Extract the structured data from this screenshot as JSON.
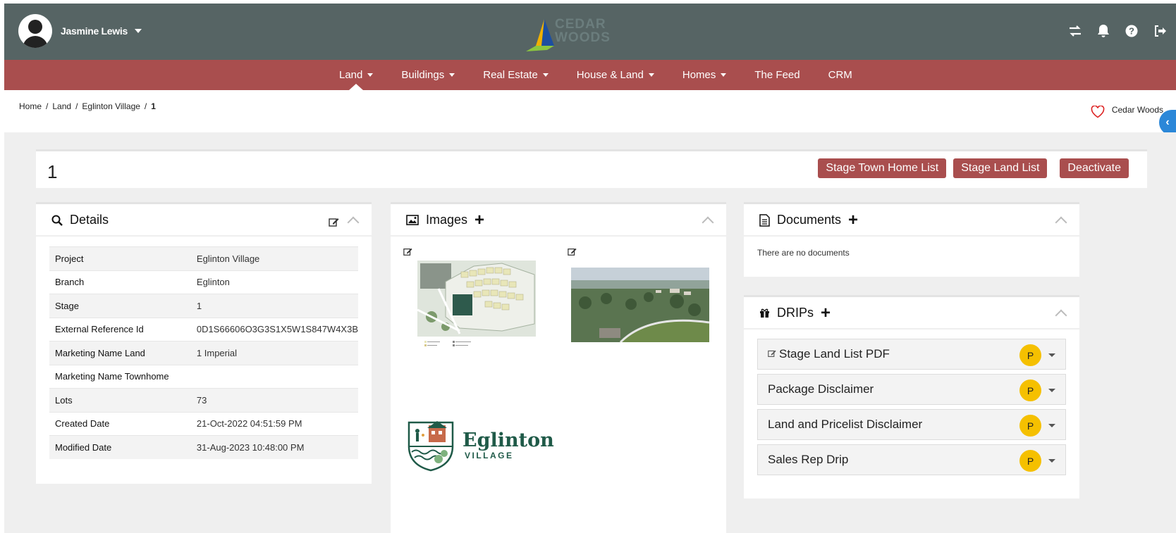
{
  "header": {
    "user_name": "Jasmine Lewis",
    "logo_text": "CEDAR WOODS",
    "icons": [
      "swap-icon",
      "bell-icon",
      "help-icon",
      "logout-icon"
    ]
  },
  "nav": {
    "items": [
      {
        "label": "Land",
        "dropdown": true,
        "active": true
      },
      {
        "label": "Buildings",
        "dropdown": true
      },
      {
        "label": "Real Estate",
        "dropdown": true
      },
      {
        "label": "House & Land",
        "dropdown": true
      },
      {
        "label": "Homes",
        "dropdown": true
      },
      {
        "label": "The Feed",
        "dropdown": false
      },
      {
        "label": "CRM",
        "dropdown": false
      }
    ]
  },
  "breadcrumb": {
    "items": [
      "Home",
      "Land",
      "Eglinton Village"
    ],
    "current": "1"
  },
  "favorite": {
    "label": "Cedar Woods"
  },
  "page": {
    "title": "1",
    "actions": {
      "stage_townhome": "Stage Town Home List",
      "stage_land": "Stage Land List",
      "deactivate": "Deactivate"
    }
  },
  "details": {
    "title": "Details",
    "rows": [
      {
        "key": "Project",
        "value": "Eglinton Village"
      },
      {
        "key": "Branch",
        "value": "Eglinton"
      },
      {
        "key": "Stage",
        "value": "1"
      },
      {
        "key": "External Reference Id",
        "value": "0D1S66606O3G3S1X5W1S847W4X3B"
      },
      {
        "key": "Marketing Name Land",
        "value": "1 Imperial"
      },
      {
        "key": "Marketing Name Townhome",
        "value": ""
      },
      {
        "key": "Lots",
        "value": "73"
      },
      {
        "key": "Created Date",
        "value": "21-Oct-2022   04:51:59 PM"
      },
      {
        "key": "Modified Date",
        "value": "31-Aug-2023   10:48:00 PM"
      }
    ]
  },
  "images": {
    "title": "Images",
    "brand_name": "Eglinton",
    "brand_sub": "VILLAGE"
  },
  "documents": {
    "title": "Documents",
    "empty": "There are no documents"
  },
  "drips": {
    "title": "DRIPs",
    "items": [
      {
        "label": "Stage Land List PDF",
        "badge": "P",
        "editable": true
      },
      {
        "label": "Package Disclaimer",
        "badge": "P"
      },
      {
        "label": "Land and Pricelist Disclaimer",
        "badge": "P"
      },
      {
        "label": "Sales Rep Drip",
        "badge": "P"
      }
    ]
  },
  "colors": {
    "header_bg": "#566464",
    "nav_bg": "#a94e4e",
    "button_bg": "#a94e4e",
    "badge": "#f5c000",
    "side_tab": "#2b87d8"
  }
}
